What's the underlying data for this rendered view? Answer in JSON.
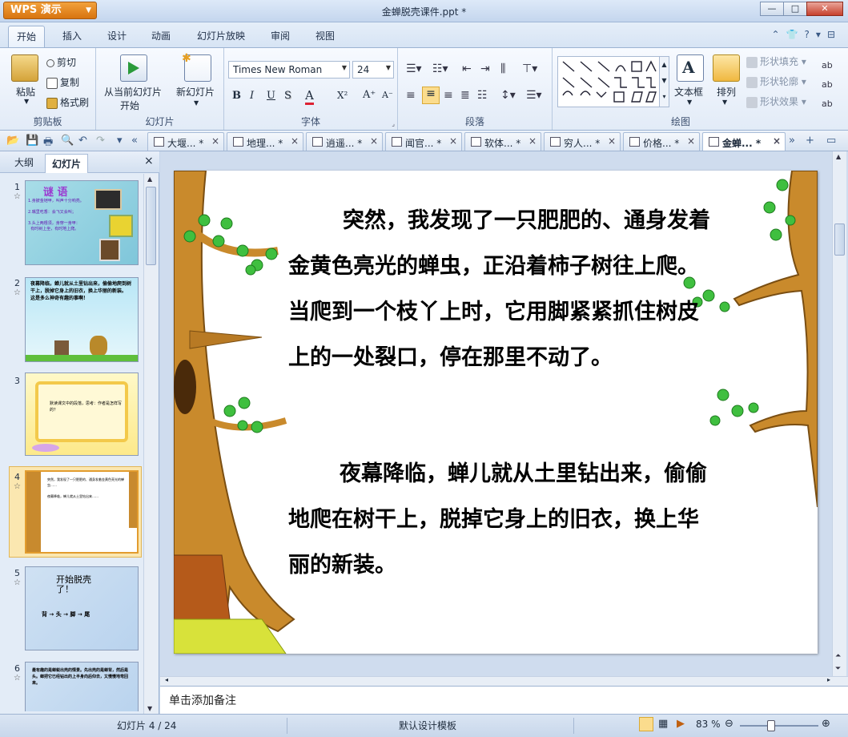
{
  "app": {
    "name": "WPS 演示",
    "document_title": "金蝉脱壳课件.ppt *"
  },
  "menu": {
    "tabs": [
      "开始",
      "插入",
      "设计",
      "动画",
      "幻灯片放映",
      "审阅",
      "视图"
    ],
    "active": "开始"
  },
  "ribbon": {
    "clipboard": {
      "paste": "粘贴",
      "cut": "剪切",
      "copy": "复制",
      "format_painter": "格式刷",
      "group": "剪贴板"
    },
    "slides": {
      "from_current": "从当前幻灯片",
      "start": "开始",
      "new_slide": "新幻灯片",
      "group": "幻灯片"
    },
    "font": {
      "name": "Times New Roman",
      "size": "24",
      "bold": "B",
      "italic": "I",
      "underline": "U",
      "shadow": "S",
      "font_color": "A",
      "superscript": "X²",
      "grow": "A⁺",
      "shrink": "A⁻",
      "group": "字体"
    },
    "paragraph": {
      "group": "段落"
    },
    "drawing": {
      "textbox": "文本框",
      "arrange": "排列",
      "fill": "形状填充",
      "outline": "形状轮廓",
      "effect": "形状效果",
      "group": "绘图"
    }
  },
  "doc_tabs": [
    {
      "label": "大堰... *"
    },
    {
      "label": "地理... *"
    },
    {
      "label": "逍遥... *"
    },
    {
      "label": "闻官... *"
    },
    {
      "label": "软体... *"
    },
    {
      "label": "穷人... *"
    },
    {
      "label": "价格... *"
    },
    {
      "label": "金蝉... *"
    }
  ],
  "left_pane": {
    "tabs": [
      "大纲",
      "幻灯片"
    ],
    "active": "幻灯片",
    "close": "×",
    "thumbs": [
      {
        "num": "1",
        "title": "谜  语",
        "text": "1.身披金铠甲，叫声十分响亮。\n\n2.嘴里吃香：会飞又会叫；\n\n3.头上两根须，身穿一身甲：\n  有时树上坐，有时地上爬。"
      },
      {
        "num": "2",
        "text": "夜幕降临，蝉儿就从土里钻出来，偷偷地爬到树干上，脱掉它身上的旧衣，换上华丽的新装。\n这是多么神奇有趣的事啊！"
      },
      {
        "num": "3",
        "text": "默读课文中的段落，思考：作者是怎样写的？"
      },
      {
        "num": "4",
        "text": "突然，我发现了一只肥肥的、通身发着金黄色亮光的蝉虫……\n\n夜幕降临，蝉儿就从土里钻出来……"
      },
      {
        "num": "5",
        "title": "开始脱壳了！",
        "steps": "背 → 头 → 脚 → 尾"
      },
      {
        "num": "6",
        "text": "最有趣的是蝉蜕出壳的情景。先出壳的是蝉背，然后是头。蝉把它已经钻出的上半身向后仰去，又慢慢地弯回来。"
      }
    ]
  },
  "slide": {
    "paragraph1": "突然，我发现了一只肥肥的、通身发着金黄色亮光的蝉虫，正沿着柿子树往上爬。当爬到一个枝丫上时，它用脚紧紧抓住树皮上的一处裂口，停在那里不动了。",
    "paragraph2": "夜幕降临，蝉儿就从土里钻出来，偷偷地爬在树干上，脱掉它身上的旧衣，换上华丽的新装。"
  },
  "notes_placeholder": "单击添加备注",
  "status": {
    "slide_info": "幻灯片 4 / 24",
    "template": "默认设计模板",
    "zoom": "83 %"
  }
}
